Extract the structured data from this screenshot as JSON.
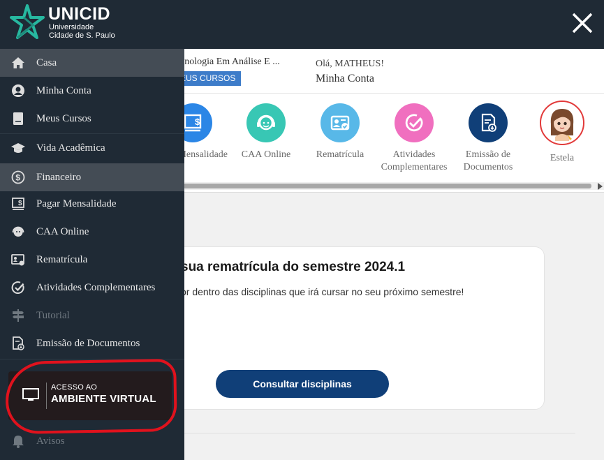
{
  "brand": {
    "name": "UNICID",
    "line1": "Universidade",
    "line2": "Cidade de S. Paulo"
  },
  "header": {
    "course_name": "cnologia Em Análise E ...",
    "my_courses_label": "EUS CURSOS",
    "greeting": "Olá, MATHEUS!",
    "account_link": "Minha Conta"
  },
  "quick_links": [
    {
      "label": "Mensalidade",
      "icon": "invoice-dollar-icon",
      "color": "#2b86e6"
    },
    {
      "label": "CAA Online",
      "icon": "support-agent-icon",
      "color": "#38c7b4"
    },
    {
      "label": "Rematrícula",
      "icon": "id-card-check-icon",
      "color": "#58b8e8"
    },
    {
      "label": "Atividades Complementares",
      "icon": "check-circle-icon",
      "color": "#f06fbf"
    },
    {
      "label": "Emissão de Documentos",
      "icon": "document-download-icon",
      "color": "#103f78"
    },
    {
      "label": "Estela",
      "icon": "avatar-estela"
    }
  ],
  "card": {
    "title": "sua rematrícula do semestre 2024.1",
    "text": "or dentro das disciplinas que irá cursar no seu próximo semestre!",
    "button_label": "Consultar disciplinas"
  },
  "sidebar": {
    "items": [
      {
        "label": "Casa",
        "icon": "home-icon",
        "state": "active"
      },
      {
        "label": "Minha Conta",
        "icon": "user-circle-icon",
        "state": "normal"
      },
      {
        "label": "Meus Cursos",
        "icon": "book-icon",
        "state": "normal"
      },
      {
        "label": "Vida Acadêmica",
        "icon": "graduation-cap-icon",
        "state": "normal"
      },
      {
        "label": "Financeiro",
        "icon": "dollar-circle-icon",
        "state": "active"
      },
      {
        "label": "Pagar Mensalidade",
        "icon": "invoice-dollar-icon",
        "state": "normal"
      },
      {
        "label": "CAA Online",
        "icon": "support-agent-icon",
        "state": "normal"
      },
      {
        "label": "Rematrícula",
        "icon": "id-card-check-icon",
        "state": "normal"
      },
      {
        "label": "Atividades Complementares",
        "icon": "check-circle-icon",
        "state": "normal"
      },
      {
        "label": "Tutorial",
        "icon": "signpost-icon",
        "state": "disabled"
      },
      {
        "label": "Emissão de Documentos",
        "icon": "document-download-icon",
        "state": "normal"
      }
    ],
    "virtual": {
      "small": "ACESSO AO",
      "big": "AMBIENTE VIRTUAL",
      "icon": "monitor-icon"
    },
    "notices": {
      "label": "Avisos",
      "icon": "bell-icon"
    }
  },
  "colors": {
    "sidebar_bg": "#1f2a35",
    "active_bg": "#444c55",
    "button_bg": "#103f78",
    "annotation_red": "#e0121d"
  }
}
